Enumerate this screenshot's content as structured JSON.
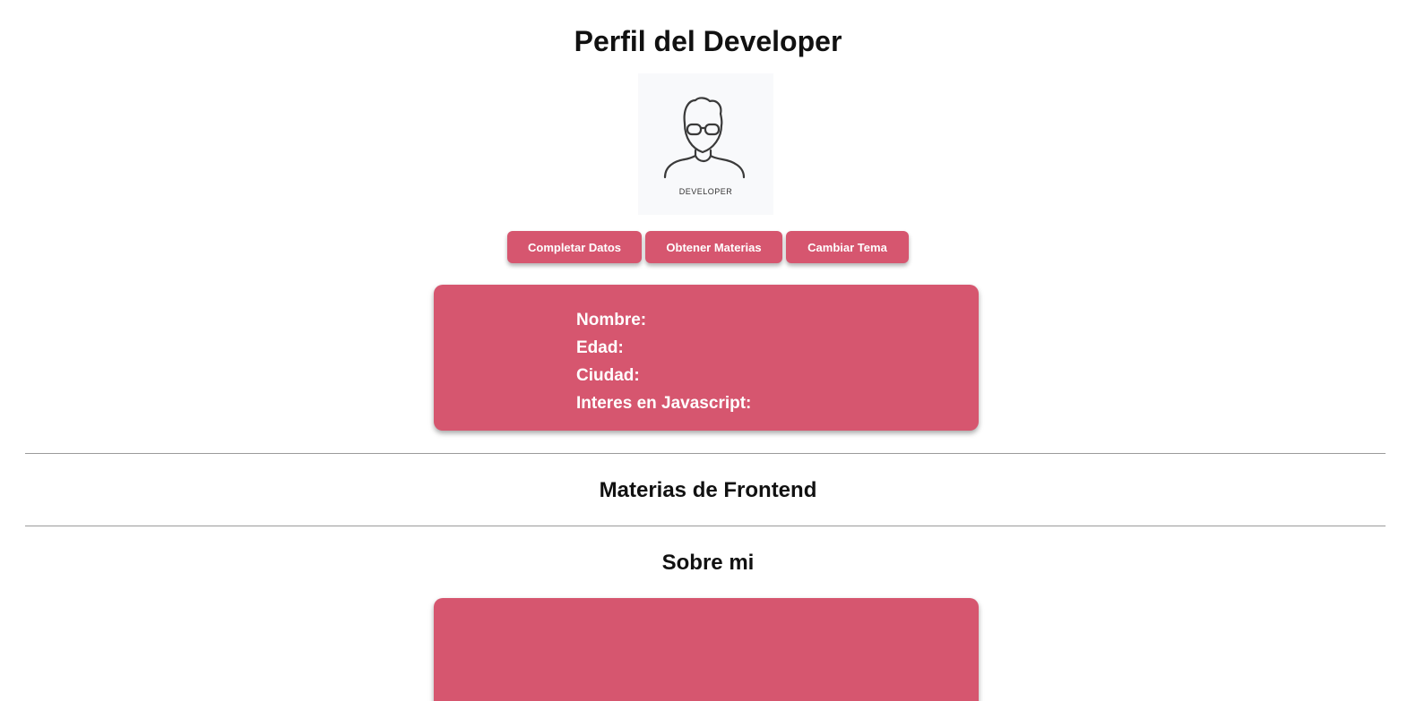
{
  "page": {
    "title": "Perfil del Developer"
  },
  "avatar": {
    "caption": "DEVELOPER",
    "icon": "developer-avatar-icon"
  },
  "toolbar": {
    "buttons": [
      {
        "label": "Completar Datos"
      },
      {
        "label": "Obtener Materias"
      },
      {
        "label": "Cambiar Tema"
      }
    ]
  },
  "profile": {
    "fields": [
      {
        "label": "Nombre:"
      },
      {
        "label": "Edad:"
      },
      {
        "label": "Ciudad:"
      },
      {
        "label": "Interes en Javascript:"
      }
    ]
  },
  "sections": {
    "materias_title": "Materias de Frontend",
    "about_title": "Sobre mi"
  },
  "colors": {
    "accent": "#d6566f",
    "background": "#ffffff",
    "avatar_background": "#f8f9fb",
    "text": "#111111"
  }
}
